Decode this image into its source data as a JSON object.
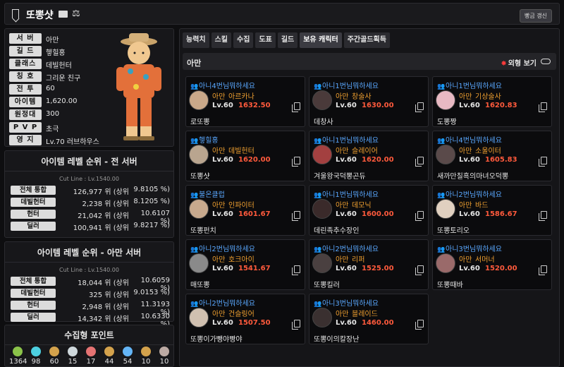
{
  "header": {
    "name": "또뽕샷",
    "refresh_label": "빵금 갱신"
  },
  "profile": {
    "rows": [
      {
        "label": "서 버",
        "value": "아만"
      },
      {
        "label": "길 드",
        "value": "헿힐홍"
      },
      {
        "label": "클래스",
        "value": "데빌헌터"
      },
      {
        "label": "칭 호",
        "value": "그리운 친구"
      },
      {
        "label": "전 투",
        "value": "60"
      },
      {
        "label": "아이템",
        "value": "1,620.00"
      },
      {
        "label": "원정대",
        "value": "300"
      },
      {
        "label": "P V P",
        "value": "초극"
      },
      {
        "label": "영 지",
        "value": "Lv.70 러브하우스"
      }
    ]
  },
  "rank_all": {
    "title": "아이템 레벨 순위 - 전 서버",
    "cutline": "Cut Line : Lv.1540.00",
    "rows": [
      {
        "label": "전체 통합",
        "rank": "126,977 위 (상위",
        "pct": "9.8105 %)"
      },
      {
        "label": "데빌헌터",
        "rank": "2,238 위 (상위",
        "pct": "8.1205 %)"
      },
      {
        "label": "헌터",
        "rank": "21,042 위 (상위",
        "pct": "10.6107 %)"
      },
      {
        "label": "딜러",
        "rank": "100,941 위 (상위",
        "pct": "9.8217 %)"
      }
    ]
  },
  "rank_server": {
    "title": "아이템 레벨 순위 - 아만 서버",
    "cutline": "Cut Line : Lv.1540.00",
    "rows": [
      {
        "label": "전체 통합",
        "rank": "18,044 위 (상위",
        "pct": "10.6059 %)"
      },
      {
        "label": "데빌헌터",
        "rank": "325 위 (상위",
        "pct": "9.0153 %)"
      },
      {
        "label": "헌터",
        "rank": "2,948 위 (상위",
        "pct": "11.3193 %)"
      },
      {
        "label": "딜러",
        "rank": "14,342 위 (상위",
        "pct": "10.6330 %)"
      }
    ]
  },
  "points": {
    "title": "수집형 포인트",
    "items": [
      {
        "icon": "island-heart-icon",
        "value": "1364",
        "color": "#8bc34a"
      },
      {
        "icon": "giant-heart-icon",
        "value": "98",
        "color": "#4dd0e1"
      },
      {
        "icon": "art-icon",
        "value": "60",
        "color": "#d4a24c"
      },
      {
        "icon": "mokoko-seed-icon",
        "value": "15",
        "color": "#cfd8dc"
      },
      {
        "icon": "adventure-icon",
        "value": "17",
        "color": "#e57373"
      },
      {
        "icon": "voyage-icon",
        "value": "44",
        "color": "#d4a24c"
      },
      {
        "icon": "star-icon",
        "value": "54",
        "color": "#64b5f6"
      },
      {
        "icon": "sun-icon",
        "value": "10",
        "color": "#d4a24c"
      },
      {
        "icon": "orpheus-icon",
        "value": "10",
        "color": "#bcaaa4"
      }
    ]
  },
  "tabs": [
    "능력치",
    "스킬",
    "수집",
    "도표",
    "길드",
    "보유 캐릭터",
    "주간골드획득"
  ],
  "active_tab": "보유 캐릭터",
  "server_bar": {
    "server": "아만",
    "look_label": "외형 보기"
  },
  "characters": [
    {
      "guild": "아니4번님뭐하세요",
      "server": "아만",
      "cls": "아르카나",
      "lv": "Lv.60",
      "ilvl": "1632.50",
      "name": "로또뽕",
      "face": "#c9a889"
    },
    {
      "guild": "아니1번님뭐하세요",
      "server": "아만",
      "cls": "창술사",
      "lv": "Lv.60",
      "ilvl": "1630.00",
      "name": "데창사",
      "face": "#4a3a3a"
    },
    {
      "guild": "아니1번님뭐하세요",
      "server": "아만",
      "cls": "기상술사",
      "lv": "Lv.60",
      "ilvl": "1620.83",
      "name": "도뽕짱",
      "face": "#e8b9c3"
    },
    {
      "guild": "헿힐홍",
      "server": "아만",
      "cls": "데빌헌터",
      "lv": "Lv.60",
      "ilvl": "1620.00",
      "name": "또뽕샷",
      "face": "#b9a58f"
    },
    {
      "guild": "아니1번님뭐하세요",
      "server": "아만",
      "cls": "슬레이어",
      "lv": "Lv.60",
      "ilvl": "1620.00",
      "name": "겨울왕국덕뽕곤듀",
      "face": "#a34040"
    },
    {
      "guild": "아니4번님뭐하세요",
      "server": "아만",
      "cls": "소울이터",
      "lv": "Lv.60",
      "ilvl": "1605.83",
      "name": "새까만칠흑의마녀오덕뽕",
      "face": "#5a4a4a"
    },
    {
      "guild": "불온클럽",
      "server": "아만",
      "cls": "인파이터",
      "lv": "Lv.60",
      "ilvl": "1601.67",
      "name": "또뽕펀치",
      "face": "#c7a98d"
    },
    {
      "guild": "아니1번님뭐하세요",
      "server": "아만",
      "cls": "데모닉",
      "lv": "Lv.60",
      "ilvl": "1600.00",
      "name": "데린족추수장인",
      "face": "#3a2a2a"
    },
    {
      "guild": "아니2번님뭐하세요",
      "server": "아만",
      "cls": "바드",
      "lv": "Lv.60",
      "ilvl": "1586.67",
      "name": "또뽕토리오",
      "face": "#e0d0c0"
    },
    {
      "guild": "아니2번님뭐하세요",
      "server": "아만",
      "cls": "호크아이",
      "lv": "Lv.60",
      "ilvl": "1541.67",
      "name": "매또뽕",
      "face": "#8a8a8a"
    },
    {
      "guild": "아니2번님뭐하세요",
      "server": "아만",
      "cls": "리퍼",
      "lv": "Lv.60",
      "ilvl": "1525.00",
      "name": "또뽕킬러",
      "face": "#4a4040"
    },
    {
      "guild": "아니3번님뭐하세요",
      "server": "아만",
      "cls": "서머너",
      "lv": "Lv.60",
      "ilvl": "1520.00",
      "name": "또뽕때바",
      "face": "#9a6a6a"
    },
    {
      "guild": "아니2번님뭐하세요",
      "server": "아만",
      "cls": "건슬링어",
      "lv": "Lv.60",
      "ilvl": "1507.50",
      "name": "또뽕이가뺑야빵야",
      "face": "#d0c0b0"
    },
    {
      "guild": "아니3번님뭐하세요",
      "server": "아만",
      "cls": "블레이드",
      "lv": "Lv.60",
      "ilvl": "1460.00",
      "name": "또뽕이의칼장난",
      "face": "#3a3030"
    }
  ]
}
